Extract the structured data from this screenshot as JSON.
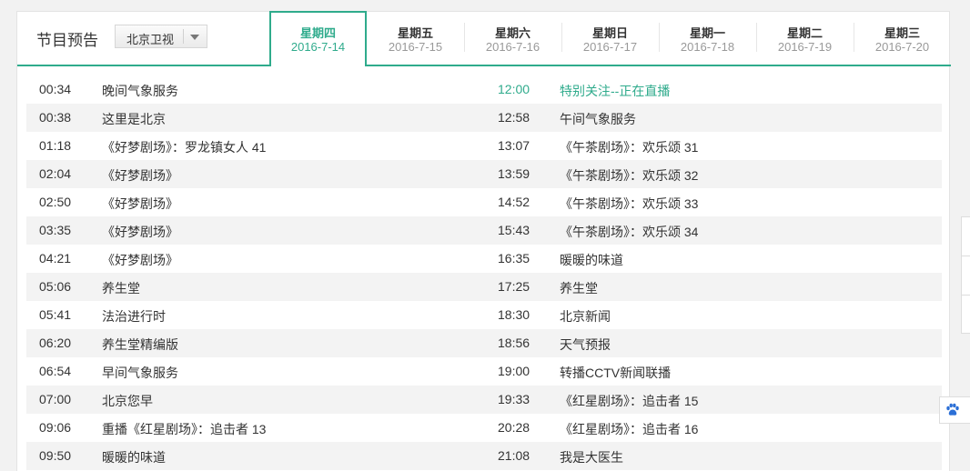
{
  "header": {
    "title": "节目预告",
    "channel_select": {
      "value": "北京卫视"
    }
  },
  "days": [
    {
      "day": "星期四",
      "date": "2016-7-14",
      "active": true
    },
    {
      "day": "星期五",
      "date": "2016-7-15"
    },
    {
      "day": "星期六",
      "date": "2016-7-16"
    },
    {
      "day": "星期日",
      "date": "2016-7-17"
    },
    {
      "day": "星期一",
      "date": "2016-7-18"
    },
    {
      "day": "星期二",
      "date": "2016-7-19"
    },
    {
      "day": "星期三",
      "date": "2016-7-20"
    }
  ],
  "schedule": [
    {
      "t1": "00:34",
      "p1": "晚间气象服务",
      "t2": "12:00",
      "p2": "特别关注--正在直播",
      "live": true
    },
    {
      "t1": "00:38",
      "p1": "这里是北京",
      "t2": "12:58",
      "p2": "午间气象服务"
    },
    {
      "t1": "01:18",
      "p1": "《好梦剧场》：罗龙镇女人 41",
      "t2": "13:07",
      "p2": "《午茶剧场》：欢乐颂 31"
    },
    {
      "t1": "02:04",
      "p1": "《好梦剧场》",
      "t2": "13:59",
      "p2": "《午茶剧场》：欢乐颂 32"
    },
    {
      "t1": "02:50",
      "p1": "《好梦剧场》",
      "t2": "14:52",
      "p2": "《午茶剧场》：欢乐颂 33"
    },
    {
      "t1": "03:35",
      "p1": "《好梦剧场》",
      "t2": "15:43",
      "p2": "《午茶剧场》：欢乐颂 34"
    },
    {
      "t1": "04:21",
      "p1": "《好梦剧场》",
      "t2": "16:35",
      "p2": "暖暖的味道"
    },
    {
      "t1": "05:06",
      "p1": "养生堂",
      "t2": "17:25",
      "p2": "养生堂"
    },
    {
      "t1": "05:41",
      "p1": "法治进行时",
      "t2": "18:30",
      "p2": "北京新闻"
    },
    {
      "t1": "06:20",
      "p1": "养生堂精编版",
      "t2": "18:56",
      "p2": "天气预报"
    },
    {
      "t1": "06:54",
      "p1": "早间气象服务",
      "t2": "19:00",
      "p2": "转播CCTV新闻联播"
    },
    {
      "t1": "07:00",
      "p1": "北京您早",
      "t2": "19:33",
      "p2": "《红星剧场》：追击者 15"
    },
    {
      "t1": "09:06",
      "p1": "重播《红星剧场》：追击者 13",
      "t2": "20:28",
      "p2": "《红星剧场》：追击者 16"
    },
    {
      "t1": "09:50",
      "p1": "暖暖的味道",
      "t2": "21:08",
      "p2": "我是大医生"
    }
  ],
  "colors": {
    "accent": "#2fab8c",
    "row_alt": "#f3f3f3"
  },
  "icons": {
    "select_caret": "chevron-down-icon",
    "floating_button": "paw-icon"
  }
}
